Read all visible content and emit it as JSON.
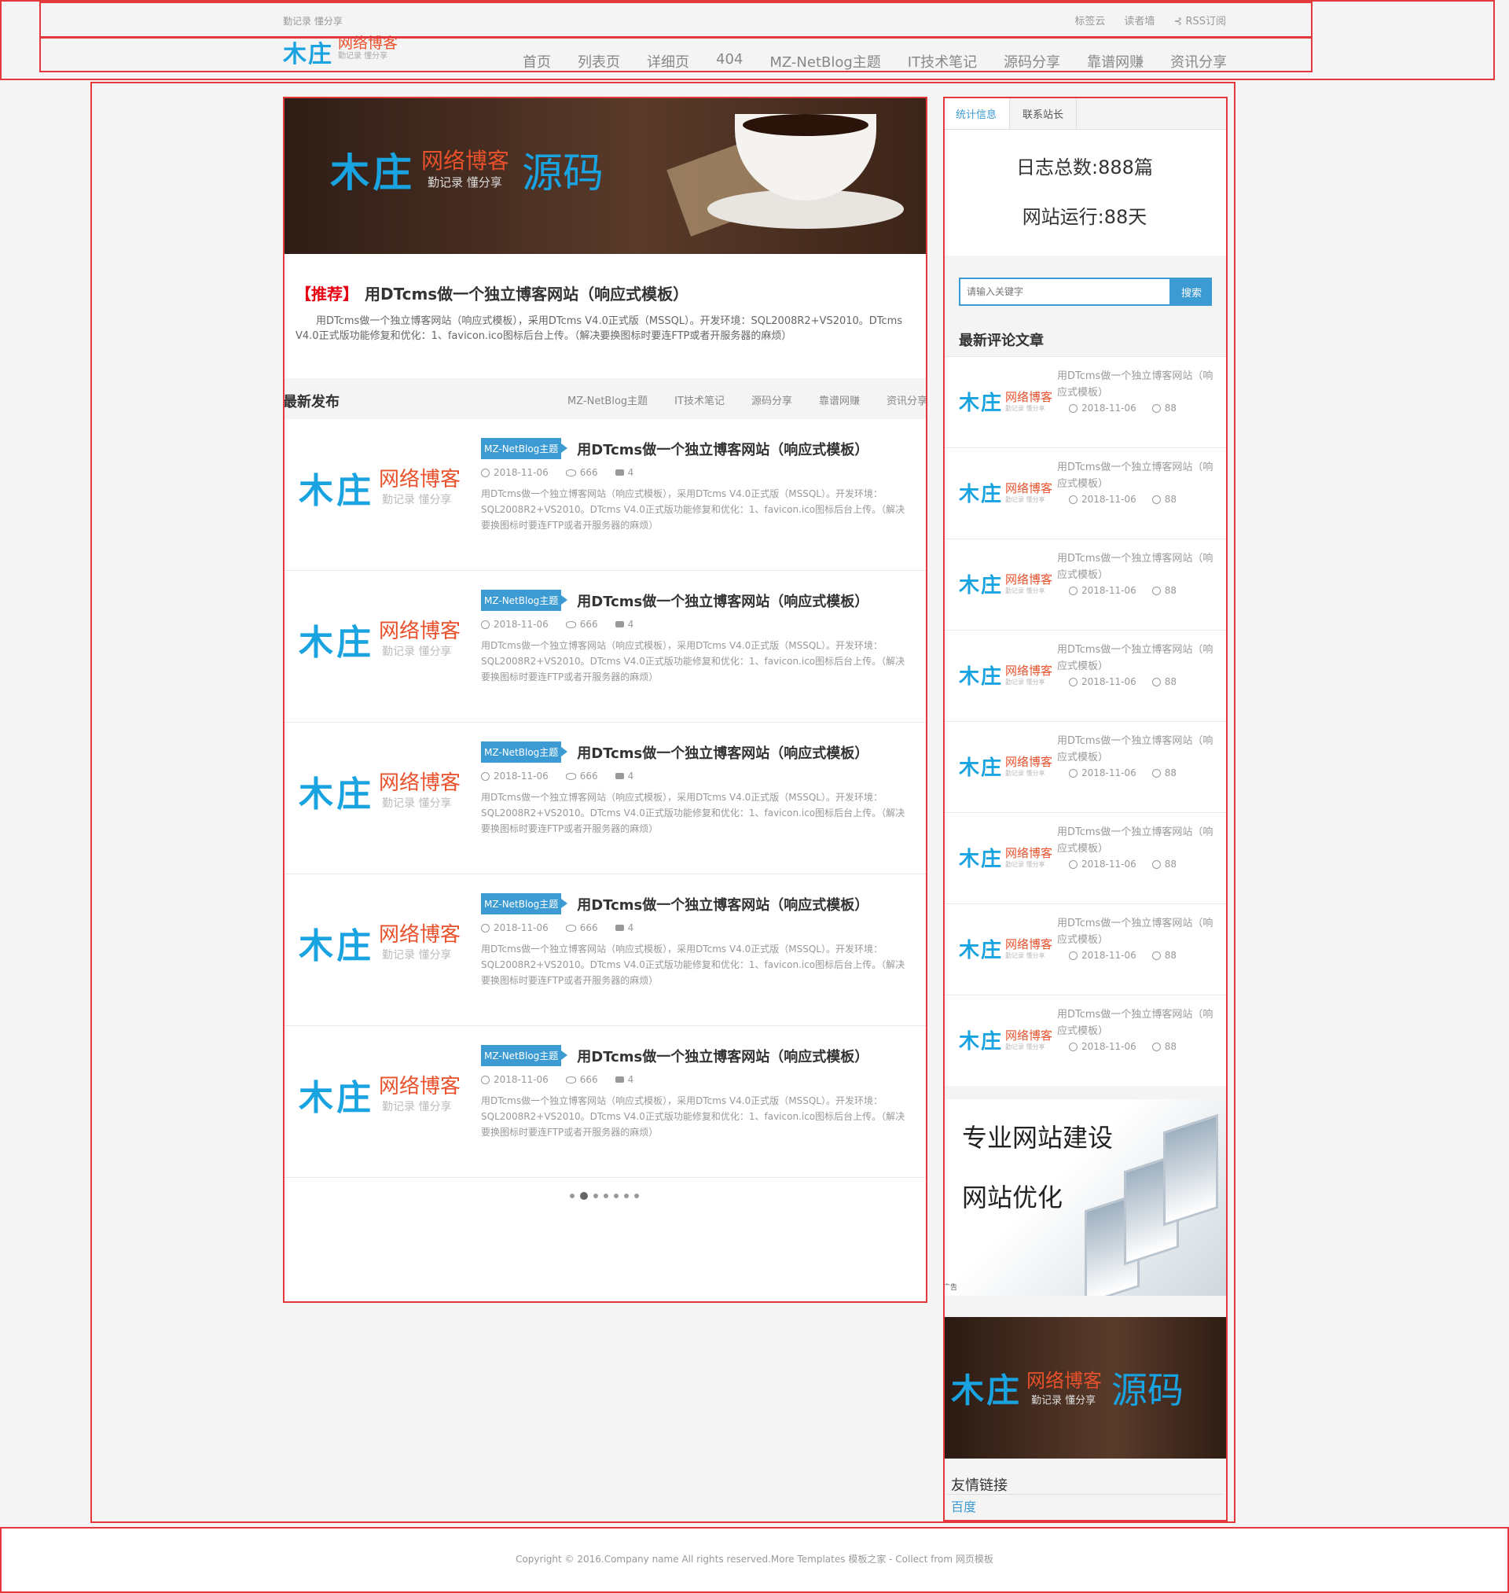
{
  "header": {
    "slogan": "勤记录 懂分享",
    "top_links": [
      "标签云",
      "读者墙",
      "RSS订阅"
    ],
    "logo": {
      "main": "木庄",
      "name": "网络博客",
      "tagline": "勤记录 懂分享"
    },
    "nav": [
      "首页",
      "列表页",
      "详细页",
      "404",
      "MZ-NetBlog主题",
      "IT技术笔记",
      "源码分享",
      "靠谱网赚",
      "资讯分享"
    ]
  },
  "banner": {
    "main": "木庄",
    "name": "网络博客",
    "tagline": "勤记录 懂分享",
    "word": "源码"
  },
  "recommend": {
    "tag": "【推荐】",
    "title": "用DTcms做一个独立博客网站（响应式模板）",
    "desc": "用DTcms做一个独立博客网站（响应式模板），采用DTcms V4.0正式版（MSSQL）。开发环境：SQL2008R2+VS2010。DTcms V4.0正式版功能修复和优化：1、favicon.ico图标后台上传。（解决要换图标时要连FTP或者开服务器的麻烦）"
  },
  "latest": {
    "title": "最新发布",
    "categories": [
      "MZ-NetBlog主题",
      "IT技术笔记",
      "源码分享",
      "靠谱网赚",
      "资讯分享"
    ],
    "thumb": {
      "main": "木庄",
      "name": "网络博客",
      "tagline": "勤记录 懂分享"
    },
    "articles": [
      {
        "category": "MZ-NetBlog主题",
        "title": "用DTcms做一个独立博客网站（响应式模板）",
        "date": "2018-11-06",
        "views": "666",
        "comments": "4",
        "desc": "用DTcms做一个独立博客网站（响应式模板），采用DTcms V4.0正式版（MSSQL）。开发环境：SQL2008R2+VS2010。DTcms V4.0正式版功能修复和优化：1、favicon.ico图标后台上传。（解决要换图标时要连FTP或者开服务器的麻烦）"
      },
      {
        "category": "MZ-NetBlog主题",
        "title": "用DTcms做一个独立博客网站（响应式模板）",
        "date": "2018-11-06",
        "views": "666",
        "comments": "4",
        "desc": "用DTcms做一个独立博客网站（响应式模板），采用DTcms V4.0正式版（MSSQL）。开发环境：SQL2008R2+VS2010。DTcms V4.0正式版功能修复和优化：1、favicon.ico图标后台上传。（解决要换图标时要连FTP或者开服务器的麻烦）"
      },
      {
        "category": "MZ-NetBlog主题",
        "title": "用DTcms做一个独立博客网站（响应式模板）",
        "date": "2018-11-06",
        "views": "666",
        "comments": "4",
        "desc": "用DTcms做一个独立博客网站（响应式模板），采用DTcms V4.0正式版（MSSQL）。开发环境：SQL2008R2+VS2010。DTcms V4.0正式版功能修复和优化：1、favicon.ico图标后台上传。（解决要换图标时要连FTP或者开服务器的麻烦）"
      },
      {
        "category": "MZ-NetBlog主题",
        "title": "用DTcms做一个独立博客网站（响应式模板）",
        "date": "2018-11-06",
        "views": "666",
        "comments": "4",
        "desc": "用DTcms做一个独立博客网站（响应式模板），采用DTcms V4.0正式版（MSSQL）。开发环境：SQL2008R2+VS2010。DTcms V4.0正式版功能修复和优化：1、favicon.ico图标后台上传。（解决要换图标时要连FTP或者开服务器的麻烦）"
      },
      {
        "category": "MZ-NetBlog主题",
        "title": "用DTcms做一个独立博客网站（响应式模板）",
        "date": "2018-11-06",
        "views": "666",
        "comments": "4",
        "desc": "用DTcms做一个独立博客网站（响应式模板），采用DTcms V4.0正式版（MSSQL）。开发环境：SQL2008R2+VS2010。DTcms V4.0正式版功能修复和优化：1、favicon.ico图标后台上传。（解决要换图标时要连FTP或者开服务器的麻烦）"
      }
    ]
  },
  "sidebar": {
    "tabs": [
      "统计信息",
      "联系站长"
    ],
    "stats": {
      "posts": "日志总数:888篇",
      "uptime": "网站运行:88天"
    },
    "search": {
      "placeholder": "请输入关键字",
      "button": "搜索"
    },
    "latest_comments_title": "最新评论文章",
    "comment_items": [
      {
        "title": "用DTcms做一个独立博客网站（响应式模板）",
        "date": "2018-11-06",
        "count": "88"
      },
      {
        "title": "用DTcms做一个独立博客网站（响应式模板）",
        "date": "2018-11-06",
        "count": "88"
      },
      {
        "title": "用DTcms做一个独立博客网站（响应式模板）",
        "date": "2018-11-06",
        "count": "88"
      },
      {
        "title": "用DTcms做一个独立博客网站（响应式模板）",
        "date": "2018-11-06",
        "count": "88"
      },
      {
        "title": "用DTcms做一个独立博客网站（响应式模板）",
        "date": "2018-11-06",
        "count": "88"
      },
      {
        "title": "用DTcms做一个独立博客网站（响应式模板）",
        "date": "2018-11-06",
        "count": "88"
      },
      {
        "title": "用DTcms做一个独立博客网站（响应式模板）",
        "date": "2018-11-06",
        "count": "88"
      },
      {
        "title": "用DTcms做一个独立博客网站（响应式模板）",
        "date": "2018-11-06",
        "count": "88"
      }
    ],
    "ad1": {
      "line1": "专业网站建设",
      "line2": "网站优化",
      "label": "广告"
    },
    "ad2": {
      "main": "木庄",
      "name": "网络博客",
      "tagline": "勤记录 懂分享",
      "word": "源码"
    },
    "friend_links_title": "友情链接",
    "friend_links": [
      "百度"
    ]
  },
  "footer": {
    "text": "Copyright © 2016.Company name All rights reserved.More Templates 模板之家 - Collect from 网页模板"
  },
  "colors": {
    "accent": "#3c9bd3",
    "logo_blue": "#1aa3e1",
    "logo_orange": "#e8512b",
    "recommend_red": "#e60012"
  }
}
